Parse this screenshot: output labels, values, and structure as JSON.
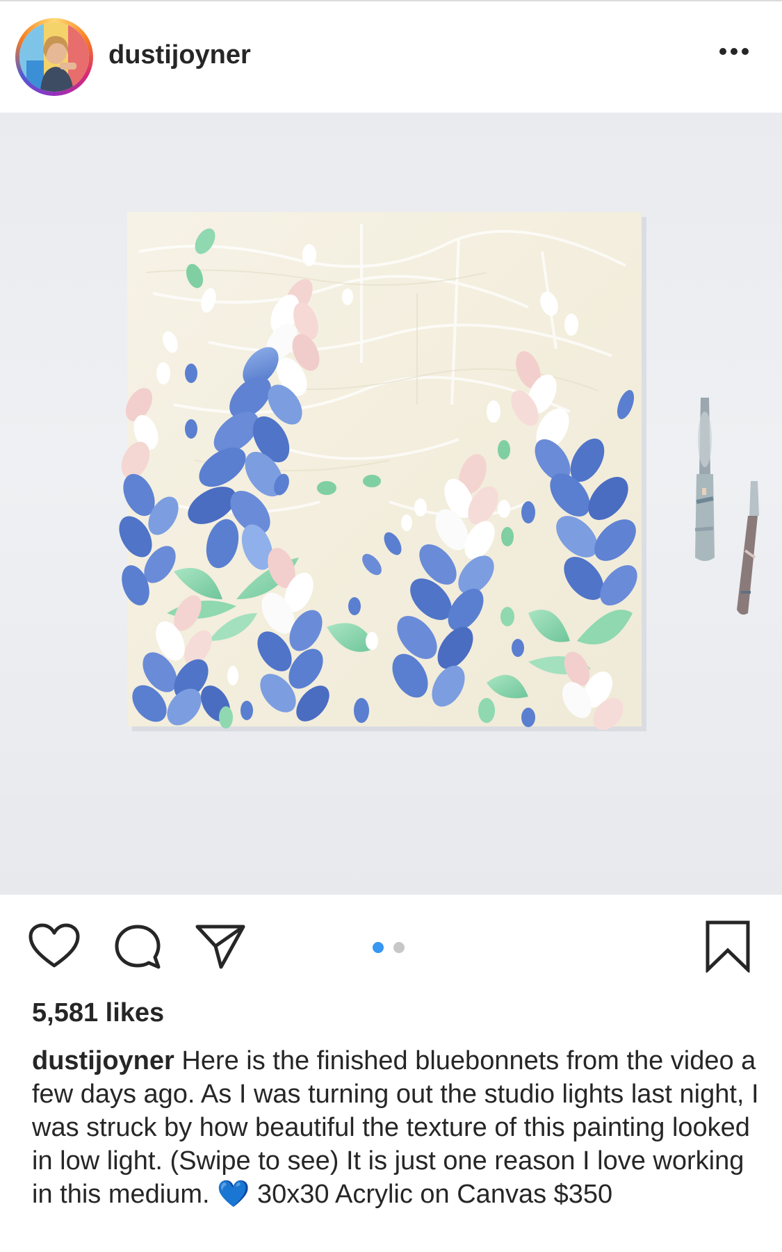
{
  "post": {
    "username": "dustijoyner",
    "more_icon": "more-horizontal-icon",
    "media_alt": "bluebonnets palette-knife painting",
    "carousel": {
      "count": 2,
      "active_index": 0
    },
    "likes_text": "5,581 likes",
    "caption": {
      "username": "dustijoyner",
      "text": " Here is the finished bluebonnets from the video a few days ago.  As I was turning out the studio lights last night, I was struck by how beautiful the texture of this painting looked in low light. (Swipe to see) It is just one reason I love working in this medium. ",
      "emoji": "💙",
      "text_after": "  30x30 Acrylic on Canvas $350"
    }
  },
  "actions": {
    "like_icon": "heart-outline-icon",
    "comment_icon": "comment-bubble-icon",
    "share_icon": "paper-plane-icon",
    "save_icon": "bookmark-outline-icon"
  },
  "colors": {
    "accent_blue": "#3897f0",
    "text_primary": "#262626",
    "divider": "#dbdbdb",
    "bluebonnet": "#5a7fd0",
    "leaf_green": "#8fd8b0",
    "petal_pink": "#f2cfcc"
  }
}
